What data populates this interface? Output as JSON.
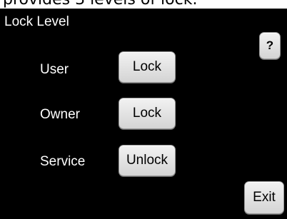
{
  "caption": "provides 3 levels of lock.",
  "screen": {
    "title": "Lock Level",
    "help_label": "?",
    "exit_label": "Exit",
    "rows": [
      {
        "label": "User",
        "button": "Lock"
      },
      {
        "label": "Owner",
        "button": "Lock"
      },
      {
        "label": "Service",
        "button": "Unlock"
      }
    ]
  }
}
